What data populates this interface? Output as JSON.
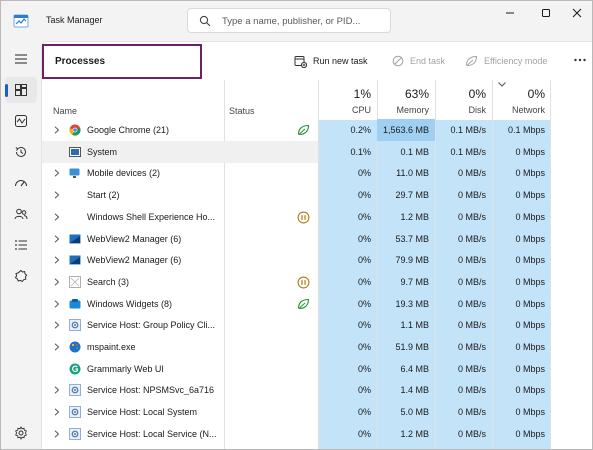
{
  "titlebar": {
    "app_title": "Task Manager",
    "search_placeholder": "Type a name, publisher, or PID..."
  },
  "nav": {
    "items": [
      "menu-icon",
      "processes-icon",
      "performance-icon",
      "app-history-icon",
      "startup-apps-icon",
      "users-icon",
      "details-icon",
      "services-icon"
    ],
    "active": "processes-icon"
  },
  "toolbar": {
    "page_title": "Processes",
    "run_new_task": "Run new task",
    "end_task": "End task",
    "efficiency_mode": "Efficiency mode"
  },
  "table": {
    "headers": {
      "name": "Name",
      "status": "Status",
      "cpu_pct": "1%",
      "cpu": "CPU",
      "memory_pct": "63%",
      "memory": "Memory",
      "disk_pct": "0%",
      "disk": "Disk",
      "network_pct": "0%",
      "network": "Network"
    },
    "rows": [
      {
        "name": "Google Chrome (21)",
        "icon": "chrome-icon",
        "expandable": true,
        "status": "efficiency-leaf-icon",
        "cpu": "0.2%",
        "memory": "1,563.6 MB",
        "disk": "0.1 MB/s",
        "network": "0.1 Mbps",
        "mem_hot": true
      },
      {
        "name": "System",
        "icon": "system-icon",
        "expandable": false,
        "status": "",
        "cpu": "0.1%",
        "memory": "0.1 MB",
        "disk": "0.1 MB/s",
        "network": "0 Mbps",
        "selected": true
      },
      {
        "name": "Mobile devices (2)",
        "icon": "mobile-devices-icon",
        "expandable": true,
        "status": "",
        "cpu": "0%",
        "memory": "11.0 MB",
        "disk": "0 MB/s",
        "network": "0 Mbps"
      },
      {
        "name": "Start (2)",
        "icon": "",
        "expandable": true,
        "status": "",
        "cpu": "0%",
        "memory": "29.7 MB",
        "disk": "0 MB/s",
        "network": "0 Mbps"
      },
      {
        "name": "Windows Shell Experience Ho...",
        "icon": "",
        "expandable": true,
        "status": "suspended-icon",
        "cpu": "0%",
        "memory": "1.2 MB",
        "disk": "0 MB/s",
        "network": "0 Mbps"
      },
      {
        "name": "WebView2 Manager (6)",
        "icon": "webview-icon",
        "expandable": true,
        "status": "",
        "cpu": "0%",
        "memory": "53.7 MB",
        "disk": "0 MB/s",
        "network": "0 Mbps"
      },
      {
        "name": "WebView2 Manager (6)",
        "icon": "webview-icon",
        "expandable": true,
        "status": "",
        "cpu": "0%",
        "memory": "79.9 MB",
        "disk": "0 MB/s",
        "network": "0 Mbps"
      },
      {
        "name": "Search (3)",
        "icon": "search-app-icon",
        "expandable": true,
        "status": "suspended-icon",
        "cpu": "0%",
        "memory": "9.7 MB",
        "disk": "0 MB/s",
        "network": "0 Mbps"
      },
      {
        "name": "Windows Widgets (8)",
        "icon": "widgets-icon",
        "expandable": true,
        "status": "efficiency-leaf-icon",
        "cpu": "0%",
        "memory": "19.3 MB",
        "disk": "0 MB/s",
        "network": "0 Mbps"
      },
      {
        "name": "Service Host: Group Policy Cli...",
        "icon": "service-host-icon",
        "expandable": true,
        "status": "",
        "cpu": "0%",
        "memory": "1.1 MB",
        "disk": "0 MB/s",
        "network": "0 Mbps"
      },
      {
        "name": "mspaint.exe",
        "icon": "paint-icon",
        "expandable": true,
        "status": "",
        "cpu": "0%",
        "memory": "51.9 MB",
        "disk": "0 MB/s",
        "network": "0 Mbps"
      },
      {
        "name": "Grammarly Web UI",
        "icon": "grammarly-icon",
        "expandable": false,
        "status": "",
        "cpu": "0%",
        "memory": "6.4 MB",
        "disk": "0 MB/s",
        "network": "0 Mbps"
      },
      {
        "name": "Service Host: NPSMSvc_6a716",
        "icon": "service-host-icon",
        "expandable": true,
        "status": "",
        "cpu": "0%",
        "memory": "1.4 MB",
        "disk": "0 MB/s",
        "network": "0 Mbps"
      },
      {
        "name": "Service Host: Local System",
        "icon": "service-host-icon",
        "expandable": true,
        "status": "",
        "cpu": "0%",
        "memory": "5.0 MB",
        "disk": "0 MB/s",
        "network": "0 Mbps"
      },
      {
        "name": "Service Host: Local Service (N...",
        "icon": "service-host-icon",
        "expandable": true,
        "status": "",
        "cpu": "0%",
        "memory": "1.2 MB",
        "disk": "0 MB/s",
        "network": "0 Mbps"
      }
    ]
  },
  "colors": {
    "accent": "#1b5fc1",
    "highlight_border": "#6b2363",
    "column_fill": "#c3e3f8",
    "column_fill_hot": "#9fd0f2",
    "efficiency_green": "#2f8f3a",
    "suspended_amber": "#b07a12"
  }
}
